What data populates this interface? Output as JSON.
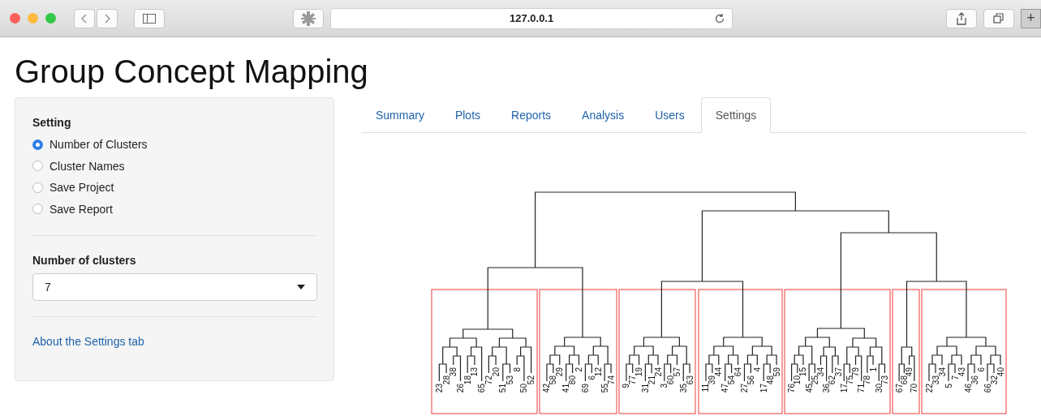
{
  "browser": {
    "url": "127.0.0.1",
    "new_tab": "+"
  },
  "title": "Group Concept Mapping",
  "sidebar": {
    "heading": "Setting",
    "options": [
      {
        "label": "Number of Clusters",
        "selected": true
      },
      {
        "label": "Cluster Names",
        "selected": false
      },
      {
        "label": "Save Project",
        "selected": false
      },
      {
        "label": "Save Report",
        "selected": false
      }
    ],
    "select_label": "Number of clusters",
    "select_value": "7",
    "link": "About the Settings tab"
  },
  "tabs": [
    {
      "label": "Summary",
      "selected": false
    },
    {
      "label": "Plots",
      "selected": false
    },
    {
      "label": "Reports",
      "selected": false
    },
    {
      "label": "Analysis",
      "selected": false
    },
    {
      "label": "Users",
      "selected": false
    },
    {
      "label": "Settings",
      "selected": true
    }
  ],
  "dendrogram": {
    "clusters": [
      {
        "leaves": [
          "23",
          "28",
          "38",
          "26",
          "18",
          "13",
          "65",
          "72",
          "20",
          "51",
          "53",
          "8",
          "50",
          "52"
        ]
      },
      {
        "leaves": [
          "42",
          "58",
          "29",
          "41",
          "80",
          "2",
          "69",
          "6",
          "12",
          "55",
          "74"
        ]
      },
      {
        "leaves": [
          "9",
          "77",
          "19",
          "31",
          "21",
          "24",
          "3",
          "60",
          "57",
          "35",
          "63"
        ]
      },
      {
        "leaves": [
          "11",
          "39",
          "44",
          "47",
          "54",
          "64",
          "27",
          "56",
          "4",
          "17",
          "48",
          "59"
        ]
      },
      {
        "leaves": [
          "76",
          "10",
          "15",
          "45",
          "25",
          "34",
          "36",
          "62",
          "37",
          "17",
          "75",
          "79",
          "71",
          "78",
          "1",
          "30",
          "73"
        ]
      },
      {
        "leaves": [
          "67",
          "68",
          "49",
          "70"
        ]
      },
      {
        "leaves": [
          "22",
          "33",
          "34",
          "5",
          "7",
          "43",
          "46",
          "36",
          "6",
          "66",
          "32",
          "40"
        ]
      }
    ]
  }
}
